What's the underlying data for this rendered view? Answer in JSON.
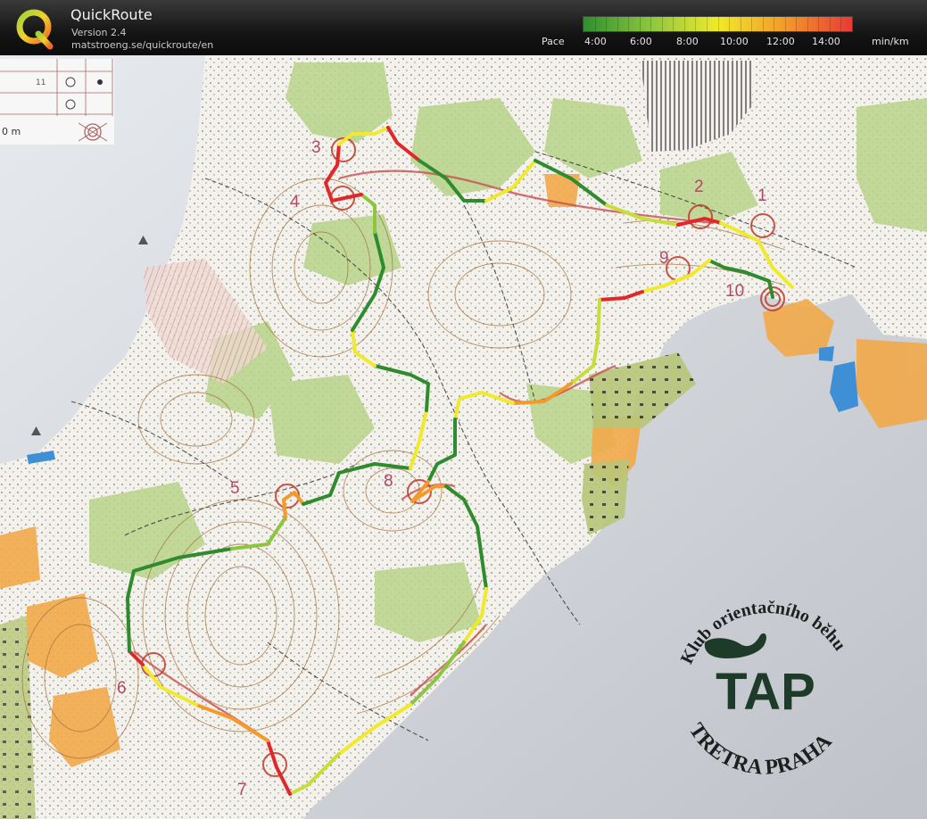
{
  "app": {
    "title": "QuickRoute",
    "version": "Version 2.4",
    "url": "matstroeng.se/quickroute/en",
    "logo_letter": "Q"
  },
  "legend": {
    "label": "Pace",
    "ticks": [
      "4:00",
      "6:00",
      "8:00",
      "10:00",
      "12:00",
      "14:00"
    ],
    "unit": "min/km",
    "colors": [
      "#2f8f2f",
      "#8cc63f",
      "#f0ea2a",
      "#f39a2a",
      "#e83a35"
    ]
  },
  "map": {
    "controls": [
      "1",
      "2",
      "3",
      "4",
      "5",
      "6",
      "7",
      "8",
      "9",
      "10"
    ],
    "scale_text": "0 m",
    "description_cell": "11",
    "club_logo": {
      "text_top": "Klub orientačního běhu",
      "text_bottom": "TRETRA PRAHA",
      "initials": "TAP"
    }
  },
  "colors": {
    "water": "#dde3ea",
    "land": "#f4f2ee",
    "forest": "#b9d68a",
    "open": "#f2a94a",
    "control": "#c0392b",
    "route_fast": "#2e8b2e",
    "route_slow": "#e2262a"
  }
}
